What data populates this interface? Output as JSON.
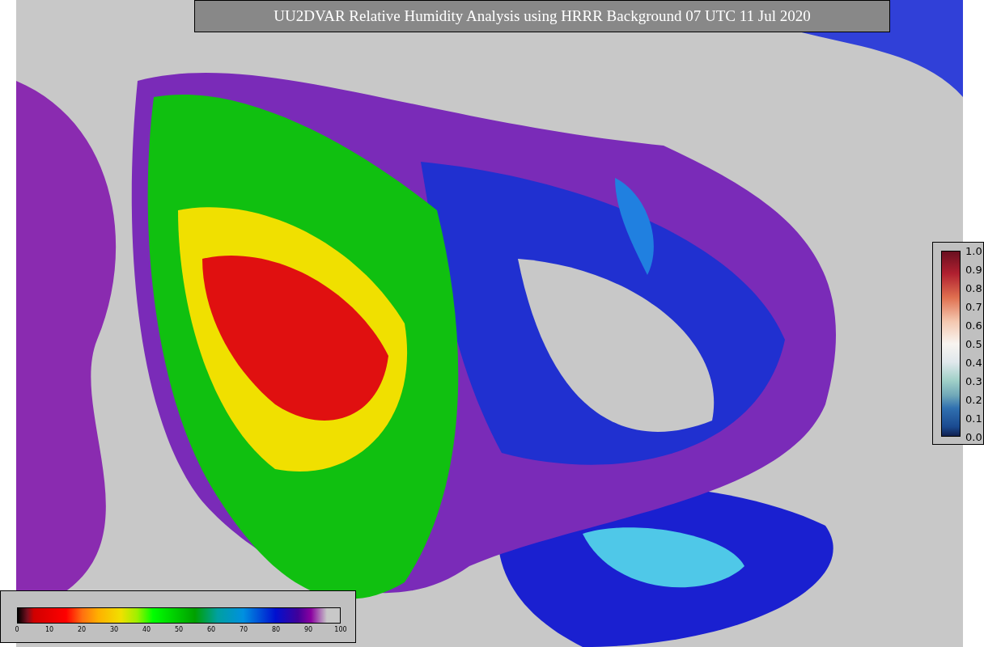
{
  "title": "UU2DVAR Relative Humidity Analysis using HRRR Background 07 UTC 11 Jul 2020",
  "humidity_colorbar": {
    "ticks": [
      "0",
      "10",
      "20",
      "30",
      "40",
      "50",
      "60",
      "70",
      "80",
      "90",
      "100"
    ]
  },
  "obs_colorbar": {
    "ticks": [
      "1.0",
      "0.9",
      "0.8",
      "0.7",
      "0.6",
      "0.5",
      "0.4",
      "0.3",
      "0.2",
      "0.1",
      "0.0"
    ]
  }
}
